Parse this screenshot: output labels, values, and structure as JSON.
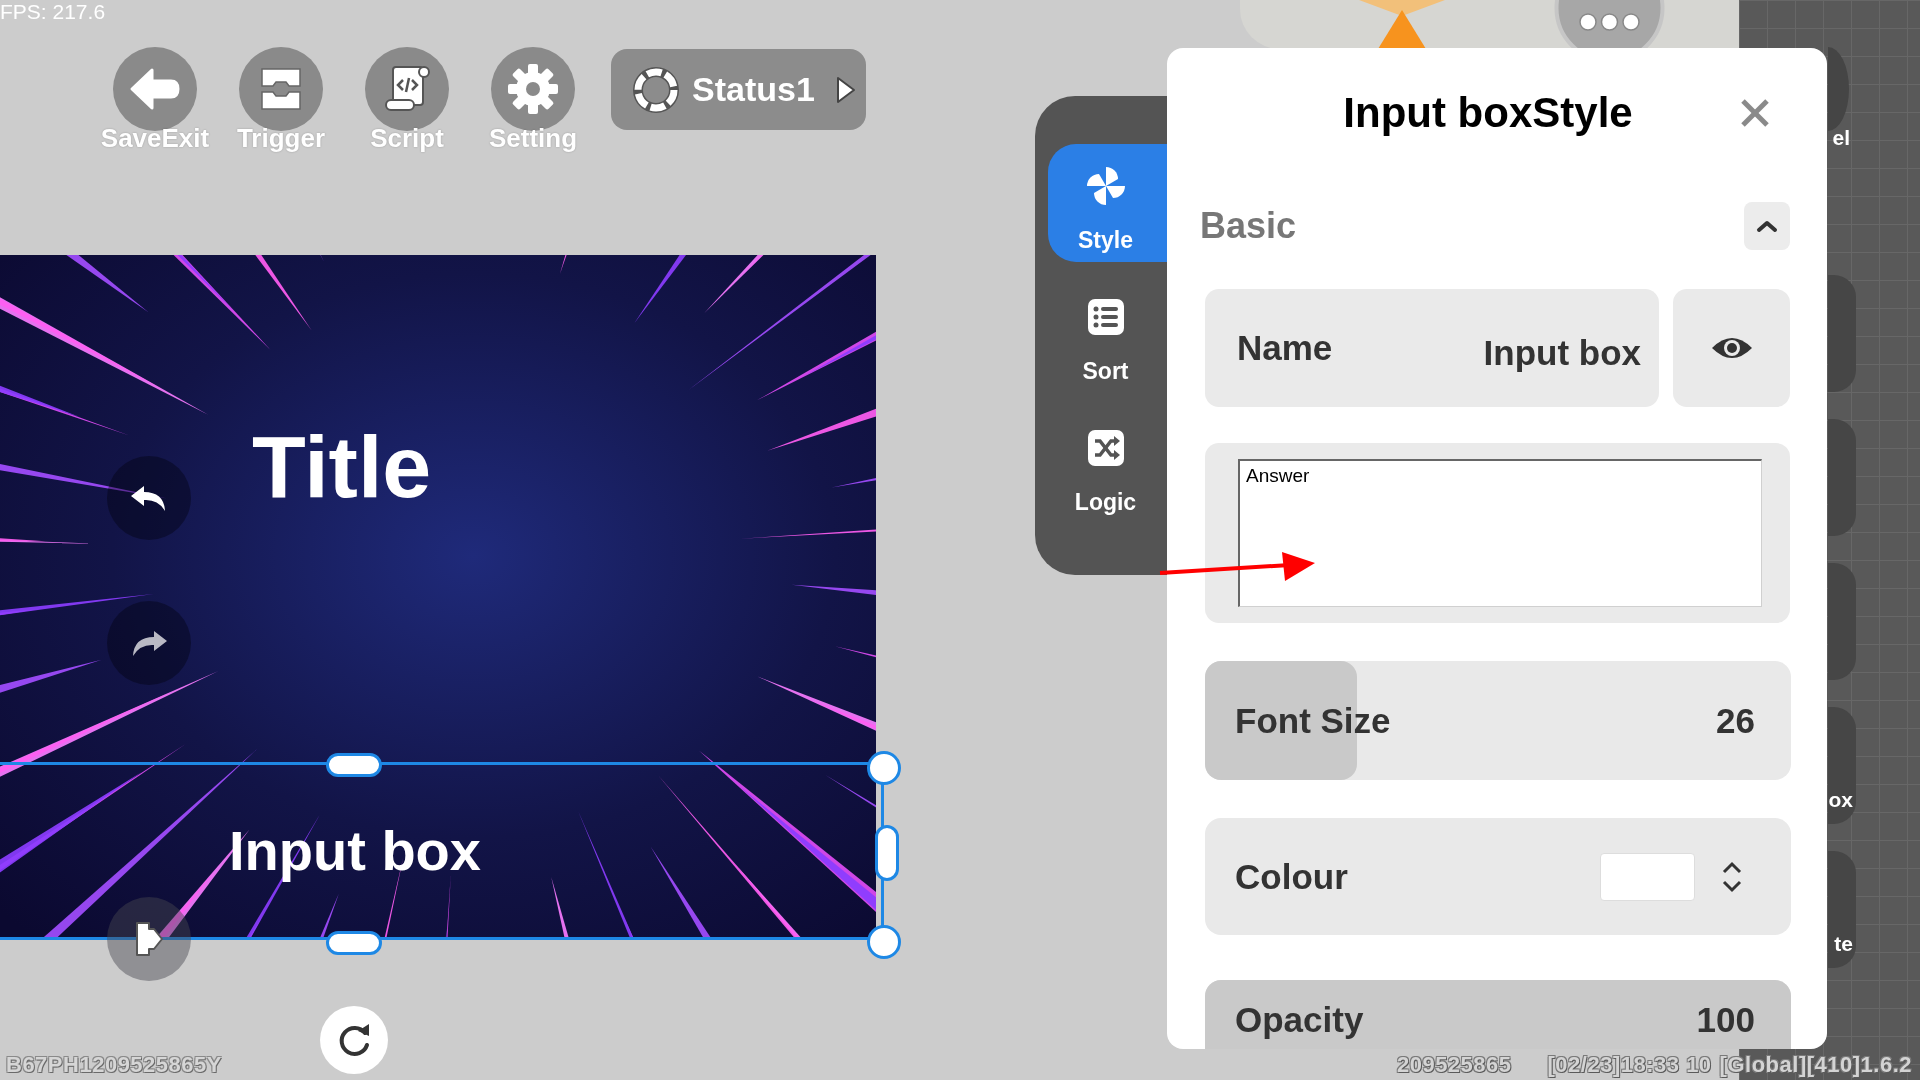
{
  "fps": "FPS: 217.6",
  "toolbar": {
    "buttons": [
      {
        "kind": "exit",
        "label": "SaveExit"
      },
      {
        "kind": "trigger",
        "label": "Trigger"
      },
      {
        "kind": "script",
        "label": "Script"
      },
      {
        "kind": "settings",
        "label": "Setting"
      }
    ],
    "status": {
      "label": "Status1"
    }
  },
  "canvas": {
    "title": "Title",
    "history": [
      {
        "kind": "undo",
        "disabled": false
      },
      {
        "kind": "redo",
        "disabled": true
      }
    ],
    "selected_element": {
      "text": "Input box"
    }
  },
  "device_id": "B67PH1209525865Y",
  "side_tabs": [
    {
      "kind": "style",
      "label": "Style",
      "selected": true
    },
    {
      "kind": "sort",
      "label": "Sort",
      "selected": false
    },
    {
      "kind": "logic",
      "label": "Logic",
      "selected": false
    }
  ],
  "panel": {
    "title": "Input boxStyle",
    "section": {
      "label": "Basic",
      "expanded": true
    },
    "name": {
      "label": "Name",
      "value": "Input box",
      "visible": true
    },
    "answer": {
      "value": "Answer"
    },
    "font_size": {
      "label": "Font Size",
      "value": "26",
      "level": 0.26
    },
    "colour": {
      "label": "Colour",
      "color": "#ffffff"
    },
    "opacity": {
      "label": "Opacity",
      "value": "100",
      "level": 1
    }
  },
  "rail": {
    "top_label": "el",
    "buttons": [
      {
        "label": "ox"
      },
      {
        "label": "te"
      }
    ]
  },
  "status_bar": [
    "209525865",
    "[02/23]18:33 10",
    "[Global][410]1.6.2"
  ]
}
